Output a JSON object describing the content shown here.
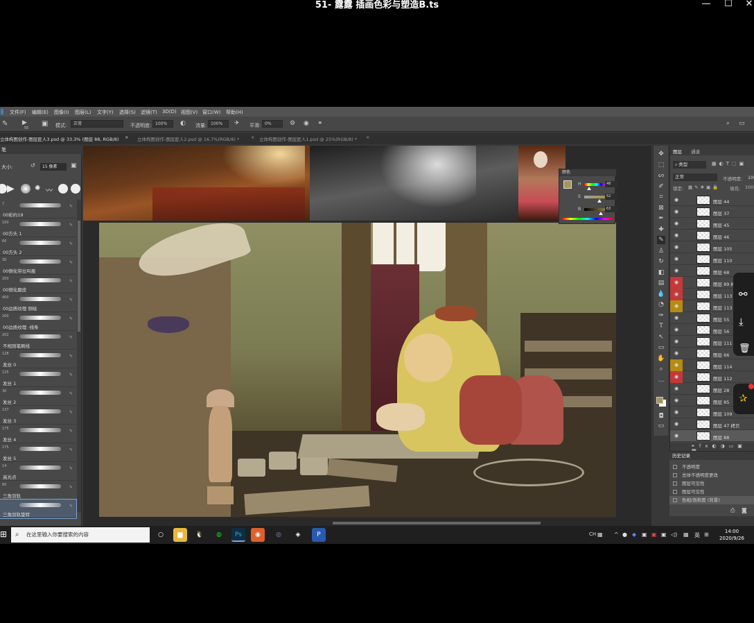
{
  "player": {
    "title": "51- 露露 插画色彩与塑造B.ts",
    "controls": {
      "minimize": "—",
      "maximize": "☐",
      "close": "✕"
    }
  },
  "ps": {
    "menu": [
      "文件(F)",
      "编辑(E)",
      "图像(I)",
      "图层(L)",
      "文字(Y)",
      "选择(S)",
      "滤镜(T)",
      "3D(D)",
      "视图(V)",
      "窗口(W)",
      "帮助(H)"
    ],
    "options": {
      "brush_size": "55",
      "mode_label": "模式:",
      "mode_value": "正常",
      "opacity_label": "不透明度:",
      "opacity_value": "100%",
      "flow_label": "流量:",
      "flow_value": "100%",
      "smooth_label": "平滑:",
      "smooth_value": "0%"
    },
    "tabs": [
      {
        "label": "立体构图创作-图层匠人3.psd @ 33.3% (图层 88, RGB/8)",
        "active": true
      },
      {
        "label": "立体构图创作-图层匠人2.psd @ 16.7%(RGB/8) *",
        "active": false
      },
      {
        "label": "立体构图创作-图层匠人1.psd @ 25%(RGB/8) *",
        "active": false
      }
    ],
    "brushes": {
      "header": "笔",
      "size_label": "大小:",
      "size_value": "15 像素",
      "items": [
        {
          "num": "7",
          "name": "00彩约19"
        },
        {
          "num": "100",
          "name": "00方头 1"
        },
        {
          "num": "60",
          "name": "00方头 2"
        },
        {
          "num": "30",
          "name": "00侧化带位叫痕"
        },
        {
          "num": "200",
          "name": "00侧化磨皮"
        },
        {
          "num": "400",
          "name": "00边质纹理 侧绘"
        },
        {
          "num": "200",
          "name": "00边质纹理 -线条"
        },
        {
          "num": "202",
          "name": "不规则笔刷线"
        },
        {
          "num": "128",
          "name": "发丝 0"
        },
        {
          "num": "125",
          "name": "发丝 1"
        },
        {
          "num": "30",
          "name": "发丝 2"
        },
        {
          "num": "137",
          "name": "发丝 3"
        },
        {
          "num": "175",
          "name": "发丝 4"
        },
        {
          "num": "175",
          "name": "发丝 5"
        },
        {
          "num": "14",
          "name": "高光点"
        },
        {
          "num": "60",
          "name": "三角剑轨"
        },
        {
          "num": "",
          "name": "三角剑轨旋转"
        }
      ]
    },
    "color_panel": {
      "title": "颜色",
      "h_label": "H",
      "h_value": "48",
      "s_label": "S",
      "s_value": "52",
      "b_label": "B",
      "b_value": "63",
      "pct": "%",
      "deg": "°",
      "fg_color": "#a69657"
    },
    "layers": {
      "tabs": [
        "图层",
        "通道"
      ],
      "kind": "类型",
      "blend_mode": "正常",
      "opacity_label": "不透明度:",
      "opacity_value": "100",
      "lock_label": "锁定:",
      "fill_label": "填充:",
      "fill_value": "100",
      "items": [
        {
          "name": "图层 44",
          "mark": ""
        },
        {
          "name": "图层 37",
          "mark": ""
        },
        {
          "name": "图层 45",
          "mark": ""
        },
        {
          "name": "图层 46",
          "mark": ""
        },
        {
          "name": "图层 105",
          "mark": ""
        },
        {
          "name": "图层 110",
          "mark": ""
        },
        {
          "name": "图层 68",
          "mark": ""
        },
        {
          "name": "图层 89 拷",
          "mark": "red"
        },
        {
          "name": "图层 113",
          "mark": "red"
        },
        {
          "name": "图层 113",
          "mark": "yellow"
        },
        {
          "name": "图层 55",
          "mark": ""
        },
        {
          "name": "图层 56",
          "mark": ""
        },
        {
          "name": "图层 111",
          "mark": ""
        },
        {
          "name": "图层 66",
          "mark": ""
        },
        {
          "name": "图层 114",
          "mark": "yellow"
        },
        {
          "name": "图层 112",
          "mark": "red"
        },
        {
          "name": "图层 28",
          "mark": ""
        },
        {
          "name": "图层 85",
          "mark": ""
        },
        {
          "name": "图层 109",
          "mark": ""
        },
        {
          "name": "图层 47 拷贝",
          "mark": ""
        },
        {
          "name": "图层 88",
          "mark": "",
          "selected": true
        }
      ]
    },
    "history": {
      "title": "历史记录",
      "items": [
        {
          "label": "不透明度",
          "selected": false
        },
        {
          "label": "总体不透明度更改",
          "selected": false
        },
        {
          "label": "图层可见性",
          "selected": false
        },
        {
          "label": "图层可见性",
          "selected": false
        },
        {
          "label": "色相/饱和度 (背景)",
          "selected": true
        }
      ]
    }
  },
  "taskbar": {
    "search_placeholder": "在这里输入你要搜索的内容",
    "ime_lang": "英",
    "ch": "CH",
    "time": "14:00",
    "date": "2020/9/26"
  },
  "colors": {
    "ps_bg": "#383838",
    "panel": "#474747",
    "accent": "#7aa7d8",
    "marker_red": "#c4383a",
    "marker_yellow": "#b58b12"
  }
}
